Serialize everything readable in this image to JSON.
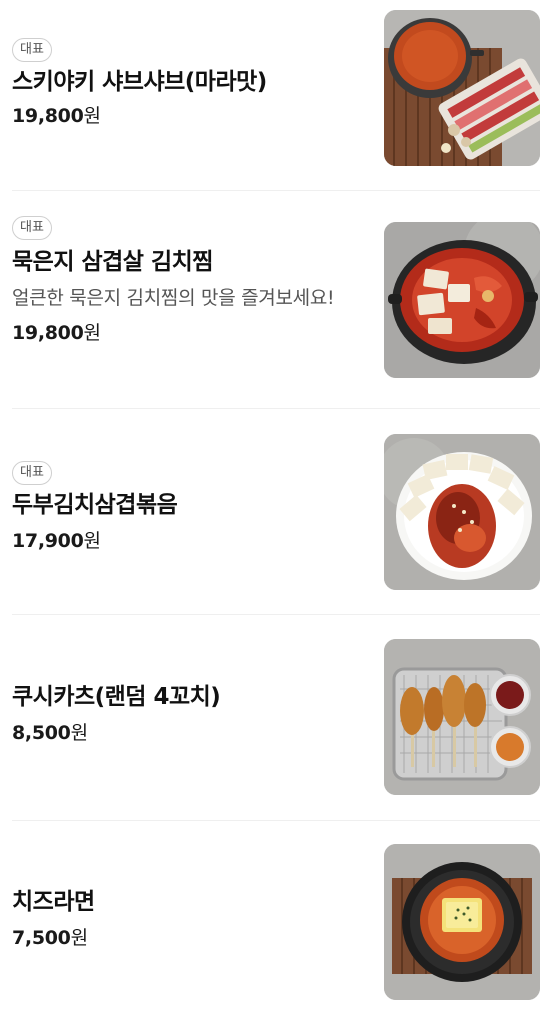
{
  "menu": {
    "items": [
      {
        "badge": "대표",
        "name": "스키야키 샤브샤브(마라맛)",
        "description": "",
        "price": "19,800",
        "currency": "원",
        "image_icon": "sukiyaki-shabu-hotpot-photo"
      },
      {
        "badge": "대표",
        "name": "묵은지 삼겹살 김치찜",
        "description": "얼큰한 묵은지 김치찜의 맛을 즐겨보세요!",
        "price": "19,800",
        "currency": "원",
        "image_icon": "kimchi-jjim-pot-photo"
      },
      {
        "badge": "대표",
        "name": "두부김치삼겹볶음",
        "description": "",
        "price": "17,900",
        "currency": "원",
        "image_icon": "tofu-kimchi-pork-plate-photo"
      },
      {
        "badge": "",
        "name": "쿠시카츠(랜덤 4꼬치)",
        "description": "",
        "price": "8,500",
        "currency": "원",
        "image_icon": "kushikatsu-skewers-photo"
      },
      {
        "badge": "",
        "name": "치즈라면",
        "description": "",
        "price": "7,500",
        "currency": "원",
        "image_icon": "cheese-ramen-bowl-photo"
      }
    ]
  },
  "colors": {
    "text_primary": "#111111",
    "text_secondary": "#555555",
    "badge_border": "#cfcfcf",
    "divider": "#efefef"
  }
}
